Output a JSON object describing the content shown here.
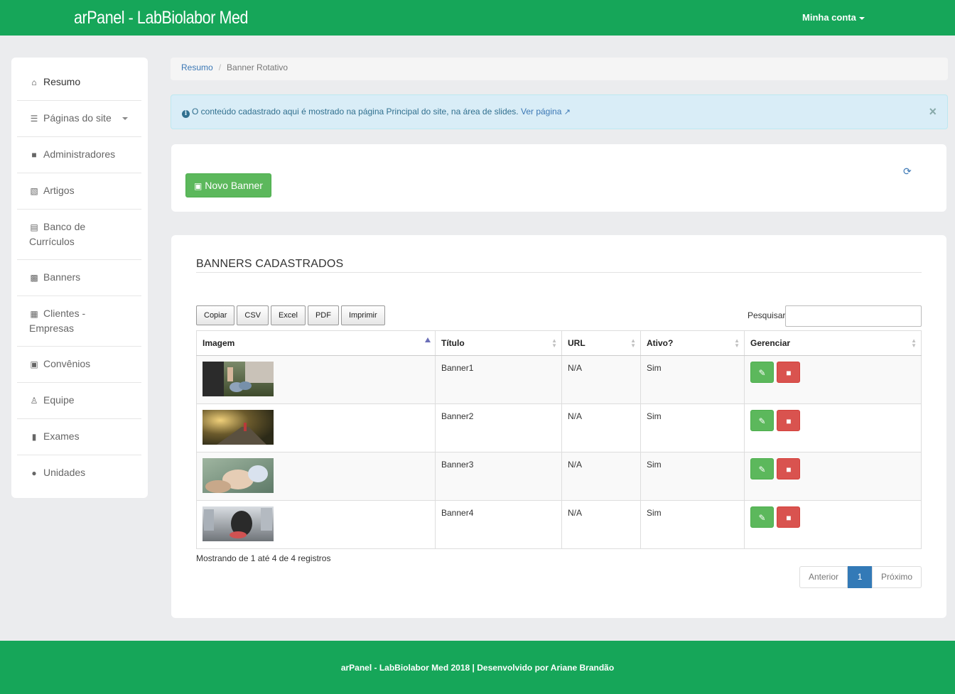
{
  "header": {
    "brand": "arPanel - LabBiolabor Med",
    "account": "Minha conta"
  },
  "sidebar": {
    "items": [
      {
        "label": "Resumo",
        "icon": "home-icon"
      },
      {
        "label": "Páginas do site",
        "icon": "list-icon"
      },
      {
        "label": "Administradores",
        "icon": "lock-icon"
      },
      {
        "label": "Artigos",
        "icon": "book-icon"
      },
      {
        "label": "Banco de Currículos",
        "icon": "id-card-icon"
      },
      {
        "label": "Banners",
        "icon": "image-icon"
      },
      {
        "label": "Clientes - Empresas",
        "icon": "building-icon"
      },
      {
        "label": "Convênios",
        "icon": "medkit-icon"
      },
      {
        "label": "Equipe",
        "icon": "user-md-icon"
      },
      {
        "label": "Exames",
        "icon": "file-icon"
      },
      {
        "label": "Unidades",
        "icon": "globe-icon"
      }
    ]
  },
  "breadcrumb": {
    "home": "Resumo",
    "current": "Banner Rotativo"
  },
  "alert": {
    "text": "O conteúdo cadastrado aqui é mostrado na página Principal do site, na área de slides.",
    "link": "Ver página",
    "close": "×"
  },
  "toolbar": {
    "new_banner": "Novo Banner"
  },
  "banners": {
    "title": "BANNERS CADASTRADOS",
    "export_buttons": [
      "Copiar",
      "CSV",
      "Excel",
      "PDF",
      "Imprimir"
    ],
    "search_label": "Pesquisar",
    "search_value": "",
    "columns": [
      "Imagem",
      "Título",
      "URL",
      "Ativo?",
      "Gerenciar"
    ],
    "rows": [
      {
        "titulo": "Banner1",
        "url": "N/A",
        "ativo": "Sim"
      },
      {
        "titulo": "Banner2",
        "url": "N/A",
        "ativo": "Sim"
      },
      {
        "titulo": "Banner3",
        "url": "N/A",
        "ativo": "Sim"
      },
      {
        "titulo": "Banner4",
        "url": "N/A",
        "ativo": "Sim"
      }
    ],
    "info": "Mostrando de 1 até 4 de 4 registros",
    "pager": {
      "prev": "Anterior",
      "current": "1",
      "next": "Próximo"
    }
  },
  "footer": {
    "text": "arPanel - LabBiolabor Med 2018 | Desenvolvido por Ariane Brandão"
  },
  "colors": {
    "brand_green": "#16a659",
    "success": "#5cb85c",
    "danger": "#d9534f",
    "info_bg": "#d9edf7",
    "primary": "#337ab7"
  }
}
